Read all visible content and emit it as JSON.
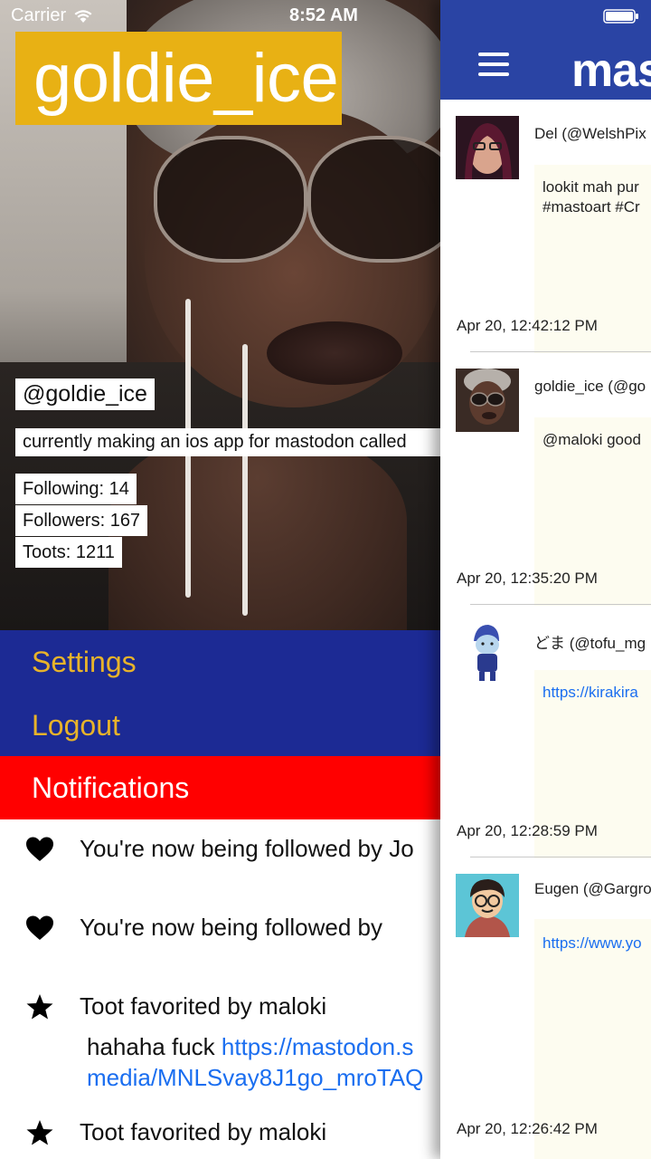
{
  "status_bar": {
    "carrier": "Carrier",
    "time": "8:52 AM"
  },
  "profile": {
    "username": "goldie_ice",
    "handle": "@goldie_ice",
    "bio": "currently making an ios app for mastodon called",
    "following": "Following: 14",
    "followers": "Followers: 167",
    "toots": "Toots: 1211"
  },
  "menu": {
    "settings": "Settings",
    "logout": "Logout",
    "notifications": "Notifications"
  },
  "notifications": [
    {
      "icon": "heart-icon",
      "text": "You're now being followed by Jo"
    },
    {
      "icon": "heart-icon",
      "text": "You're now being followed by"
    },
    {
      "icon": "star-icon",
      "text": "Toot favorited by maloki",
      "body_text": "hahaha fuck ",
      "body_link_1": "https://mastodon.s",
      "body_link_2": "media/MNLSvay8J1go_mroTAQ"
    },
    {
      "icon": "star-icon",
      "text": "Toot favorited by maloki"
    }
  ],
  "timeline": {
    "app_title": "mas",
    "toots": [
      {
        "author": "Del (@WelshPix",
        "content_1": "lookit mah pur",
        "content_2": "#mastoart #Cr",
        "time": "Apr 20, 12:42:12 PM"
      },
      {
        "author": "goldie_ice (@go",
        "content_1": "@maloki good",
        "time": "Apr 20, 12:35:20 PM"
      },
      {
        "author": "どま (@tofu_mg",
        "link": "https://kirakira",
        "time": "Apr 20, 12:28:59 PM"
      },
      {
        "author": "Eugen (@Gargro",
        "link": "https://www.yo",
        "time": "Apr 20, 12:26:42 PM"
      }
    ]
  },
  "colors": {
    "username_banner": "#e8b114",
    "menu_bg": "#1c2a94",
    "menu_text": "#e8b32a",
    "notifications_bg": "#ff0000",
    "navbar_bg": "#2a44a4",
    "link": "#1a6ef0",
    "content_bg": "#fdfcf0"
  }
}
